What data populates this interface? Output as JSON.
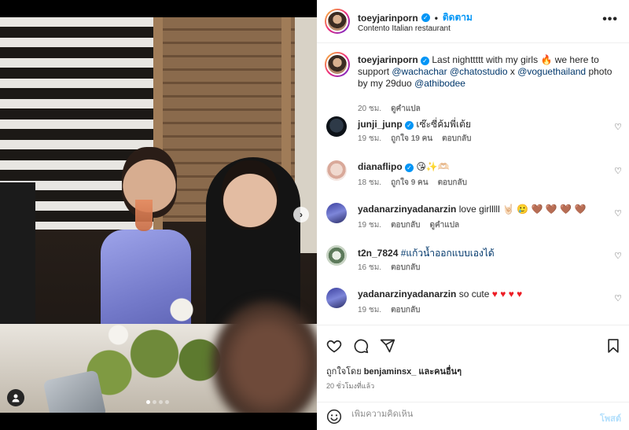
{
  "post": {
    "username": "toeyjarinporn",
    "follow_label": "ติดตาม",
    "location": "Contento Italian restaurant",
    "more_label": "•••"
  },
  "photo": {
    "next_label": "›",
    "user_tag_icon": "person-icon"
  },
  "caption": {
    "username": "toeyjarinporn",
    "text_1": "Last nighttttt with my girls",
    "emoji_fire": "🔥",
    "text_2": "we here to support",
    "mention_1": "@wachachar",
    "mention_2": "@chatostudio",
    "text_x": "x",
    "mention_3": "@voguethailand",
    "text_3": "photo by my 29duo",
    "mention_4": "@athibodee",
    "time": "20 ชม.",
    "translate": "ดูคำแปล"
  },
  "comments": [
    {
      "username": "junji_junp",
      "verified": true,
      "text": "เซ๊ะซี่ค้มพี่เต้ย",
      "time": "19 ชม.",
      "likes": "ถูกใจ 19 คน",
      "reply": "ตอบกลับ",
      "translate": ""
    },
    {
      "username": "dianaflipo",
      "verified": true,
      "text": "😘✨🫶🏻",
      "time": "18 ชม.",
      "likes": "ถูกใจ 9 คน",
      "reply": "ตอบกลับ",
      "translate": ""
    },
    {
      "username": "yadanarzinyadanarzin",
      "verified": false,
      "text": "love girlllll",
      "text_emoji": "🤘🏻 🥲 🤎 🤎 🤎 🤎",
      "time": "19 ชม.",
      "likes": "",
      "reply": "ตอบกลับ",
      "translate": "ดูคำแปล"
    },
    {
      "username": "t2n_7824",
      "verified": false,
      "text": "#แก้วน้ำออกแบบเองได้",
      "time": "16 ชม.",
      "likes": "",
      "reply": "ตอบกลับ",
      "translate": ""
    },
    {
      "username": "yadanarzinyadanarzin",
      "verified": false,
      "text": "so cute",
      "text_emoji": "♥ ♥ ♥ ♥",
      "time": "19 ชม.",
      "likes": "",
      "reply": "ตอบกลับ",
      "translate": ""
    }
  ],
  "actions": {
    "liked_by_prefix": "ถูกใจโดย",
    "liked_by_user": "benjaminsx_",
    "liked_by_suffix": "และคนอื่นๆ",
    "posted_time": "20 ชั่วโมงที่แล้ว",
    "comment_placeholder": "เพิ่มความคิดเห็น",
    "post_label": "โพสต์"
  },
  "colors": {
    "link_blue": "#0095f6",
    "mention_blue": "#00376b",
    "post_disabled": "#b2dffc",
    "heart_red": "#ed1c24"
  }
}
